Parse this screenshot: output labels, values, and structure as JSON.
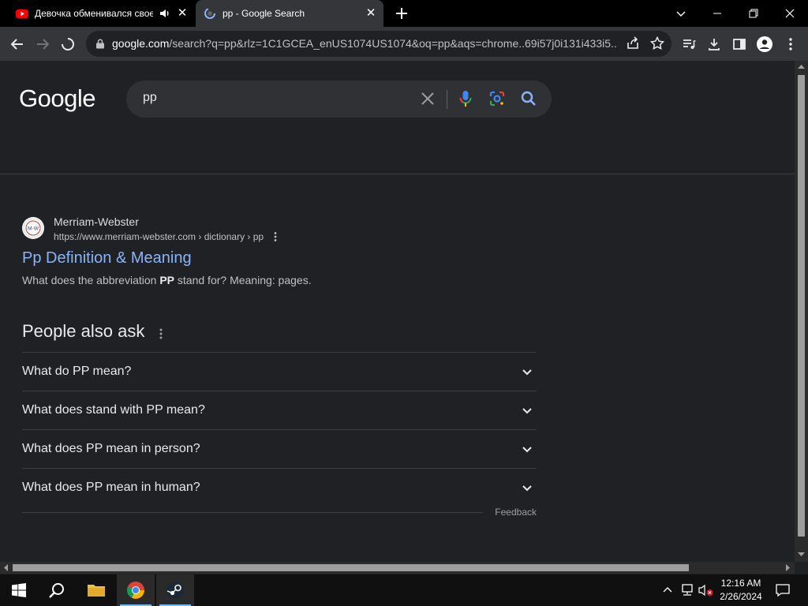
{
  "browser": {
    "tabs": [
      {
        "title": "Девочка обменивался свое",
        "favicon": "youtube-icon",
        "audio": true
      },
      {
        "title": "pp - Google Search",
        "favicon": "loading-icon",
        "active": true
      }
    ],
    "url_host": "google.com",
    "url_rest": "/search?q=pp&rlz=1C1GCEA_enUS1074US1074&oq=pp&aqs=chrome..69i57j0i131i433i5..."
  },
  "google": {
    "logo": "Google",
    "query": "pp"
  },
  "result": {
    "site_name": "Merriam-Webster",
    "favicon_text": "M-W",
    "cite": "https://www.merriam-webster.com › dictionary › pp",
    "title": "Pp Definition & Meaning",
    "snippet_pre": "What does the abbreviation ",
    "snippet_bold": "PP",
    "snippet_post": " stand for? Meaning: pages."
  },
  "paa": {
    "title": "People also ask",
    "questions": [
      "What do PP mean?",
      "What does stand with PP mean?",
      "What does PP mean in person?",
      "What does PP mean in human?"
    ],
    "feedback": "Feedback"
  },
  "taskbar": {
    "time": "12:16 AM",
    "date": "2/26/2024"
  },
  "colors": {
    "link": "#8ab4f8",
    "page_bg": "#202124",
    "taskbar_accent": "#76b9ed"
  }
}
